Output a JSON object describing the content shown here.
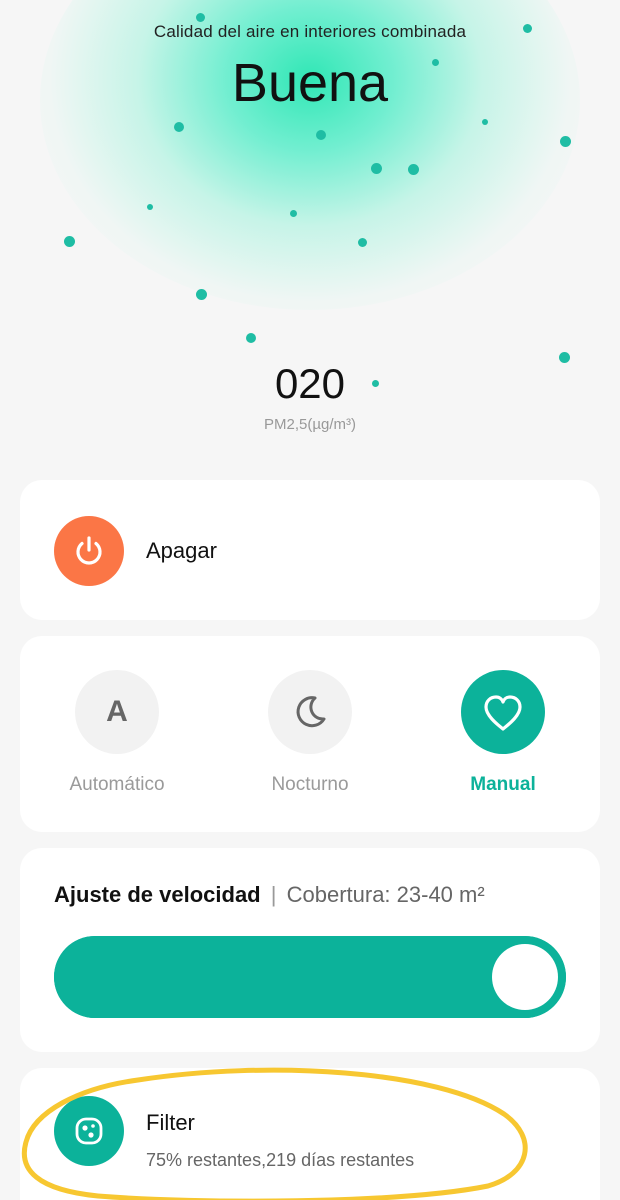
{
  "air_quality": {
    "title": "Calidad del aire en interiores combinada",
    "status": "Buena",
    "pm_value": "020",
    "pm_label": "PM2,5(µg/m³)"
  },
  "power": {
    "label": "Apagar",
    "icon": "power-icon",
    "color": "#fb7646"
  },
  "modes": {
    "items": [
      {
        "label": "Automático",
        "icon": "letter-a-icon",
        "active": false
      },
      {
        "label": "Nocturno",
        "icon": "moon-icon",
        "active": false
      },
      {
        "label": "Manual",
        "icon": "heart-icon",
        "active": true
      }
    ]
  },
  "speed": {
    "title": "Ajuste de velocidad",
    "separator": "|",
    "coverage": "Cobertura: 23-40 m²",
    "level": 1.0
  },
  "filter": {
    "title": "Filter",
    "status": "75% restantes,219 días restantes",
    "icon": "filter-icon"
  },
  "colors": {
    "accent": "#0cb29a",
    "power": "#fb7646",
    "glow": "#26e6b2",
    "annotation": "#f7c731",
    "background": "#f6f6f6"
  }
}
